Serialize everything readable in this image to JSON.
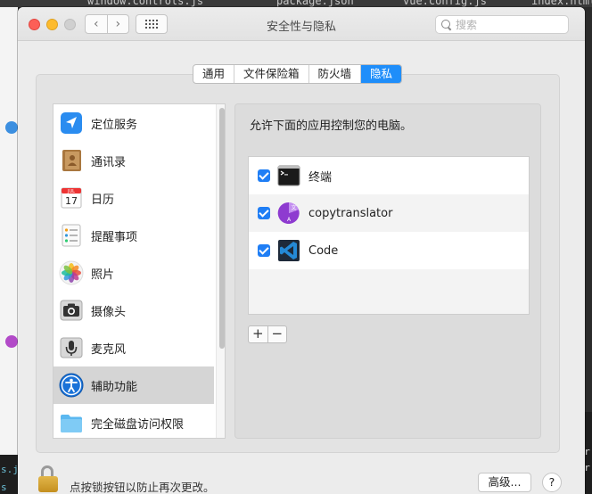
{
  "background": {
    "top_tabs": [
      "window.controls.js",
      "package.json",
      "vue.config.js",
      "index.html"
    ],
    "left_snippets": [
      "s.js",
      "s"
    ],
    "terminal_lines": [
      "our",
      "tor"
    ]
  },
  "window": {
    "title": "安全性与隐私",
    "search": {
      "placeholder": "搜索",
      "value": ""
    }
  },
  "tabs": [
    {
      "label": "通用",
      "active": false
    },
    {
      "label": "文件保险箱",
      "active": false
    },
    {
      "label": "防火墙",
      "active": false
    },
    {
      "label": "隐私",
      "active": true
    }
  ],
  "sidebar": {
    "items": [
      {
        "label": "定位服务",
        "icon": "location-arrow-icon",
        "selected": false
      },
      {
        "label": "通讯录",
        "icon": "contacts-book-icon",
        "selected": false
      },
      {
        "label": "日历",
        "icon": "calendar-icon",
        "selected": false,
        "icon_text": {
          "month": "JUL",
          "day": "17"
        }
      },
      {
        "label": "提醒事项",
        "icon": "reminders-icon",
        "selected": false
      },
      {
        "label": "照片",
        "icon": "photos-icon",
        "selected": false
      },
      {
        "label": "摄像头",
        "icon": "camera-icon",
        "selected": false
      },
      {
        "label": "麦克风",
        "icon": "microphone-icon",
        "selected": false
      },
      {
        "label": "辅助功能",
        "icon": "accessibility-icon",
        "selected": true
      },
      {
        "label": "完全磁盘访问权限",
        "icon": "folder-icon",
        "selected": false
      }
    ]
  },
  "main": {
    "description": "允许下面的应用控制您的电脑。",
    "apps": [
      {
        "name": "终端",
        "checked": true,
        "icon": "terminal-icon"
      },
      {
        "name": "copytranslator",
        "checked": true,
        "icon": "copytranslator-icon"
      },
      {
        "name": "Code",
        "checked": true,
        "icon": "vscode-icon"
      }
    ],
    "add_label": "+",
    "remove_label": "−"
  },
  "footer": {
    "lock_message": "点按锁按钮以防止再次更改。",
    "advanced_label": "高级...",
    "help_label": "?"
  },
  "colors": {
    "accent": "#1f8efa",
    "checkbox": "#1f7ef5",
    "close": "#fc5f57",
    "minimize": "#fdbb2e"
  }
}
